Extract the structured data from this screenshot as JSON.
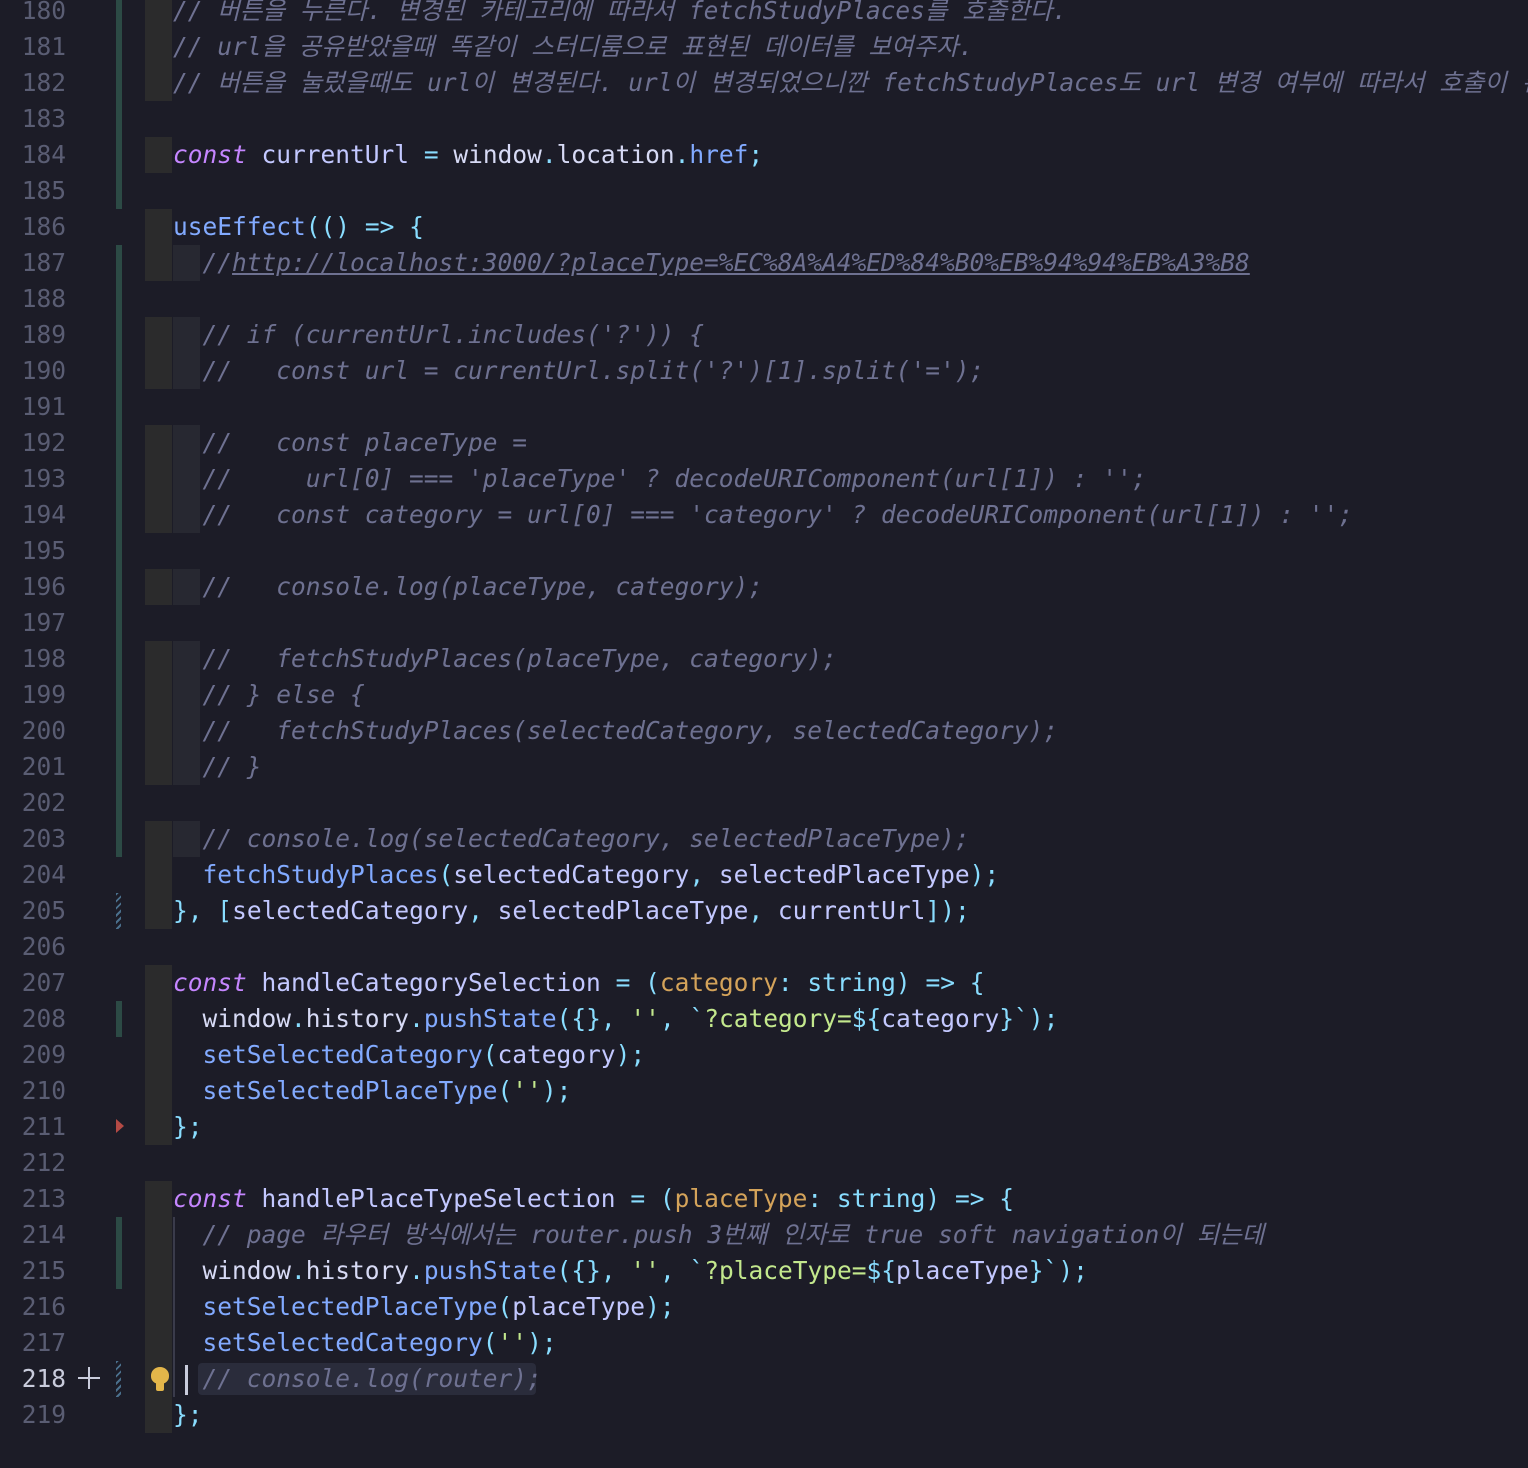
{
  "editor": {
    "active_line": "218",
    "lines": [
      {
        "num": "180",
        "text": "// 버튼을 누른다. 변경된 카테고리에 따라서 fetchStudyPlaces를 호출한다."
      },
      {
        "num": "181",
        "text": "// url을 공유받았을때 똑같이 스터디룸으로 표현된 데이터를 보여주자."
      },
      {
        "num": "182",
        "text": "// 버튼을 눌렀을때도 url이 변경된다. url이 변경되었으니깐 fetchStudyPlaces도 url 변경 여부에 따라서 호출이 된다."
      },
      {
        "num": "183",
        "text": ""
      },
      {
        "num": "184",
        "text": "const currentUrl = window.location.href;"
      },
      {
        "num": "185",
        "text": ""
      },
      {
        "num": "186",
        "text": "useEffect(() => {"
      },
      {
        "num": "187",
        "text": "  //http://localhost:3000/?placeType=%EC%8A%A4%ED%84%B0%EB%94%94%EB%A3%B8"
      },
      {
        "num": "188",
        "text": ""
      },
      {
        "num": "189",
        "text": "  // if (currentUrl.includes('?')) {"
      },
      {
        "num": "190",
        "text": "  //   const url = currentUrl.split('?')[1].split('=');"
      },
      {
        "num": "191",
        "text": ""
      },
      {
        "num": "192",
        "text": "  //   const placeType ="
      },
      {
        "num": "193",
        "text": "  //     url[0] === 'placeType' ? decodeURIComponent(url[1]) : '';"
      },
      {
        "num": "194",
        "text": "  //   const category = url[0] === 'category' ? decodeURIComponent(url[1]) : '';"
      },
      {
        "num": "195",
        "text": ""
      },
      {
        "num": "196",
        "text": "  //   console.log(placeType, category);"
      },
      {
        "num": "197",
        "text": ""
      },
      {
        "num": "198",
        "text": "  //   fetchStudyPlaces(placeType, category);"
      },
      {
        "num": "199",
        "text": "  // } else {"
      },
      {
        "num": "200",
        "text": "  //   fetchStudyPlaces(selectedCategory, selectedCategory);"
      },
      {
        "num": "201",
        "text": "  // }"
      },
      {
        "num": "202",
        "text": ""
      },
      {
        "num": "203",
        "text": "  // console.log(selectedCategory, selectedPlaceType);"
      },
      {
        "num": "204",
        "text": "  fetchStudyPlaces(selectedCategory, selectedPlaceType);"
      },
      {
        "num": "205",
        "text": "}, [selectedCategory, selectedPlaceType, currentUrl]);"
      },
      {
        "num": "206",
        "text": ""
      },
      {
        "num": "207",
        "text": "const handleCategorySelection = (category: string) => {"
      },
      {
        "num": "208",
        "text": "  window.history.pushState({}, '', `?category=${category}`);"
      },
      {
        "num": "209",
        "text": "  setSelectedCategory(category);"
      },
      {
        "num": "210",
        "text": "  setSelectedPlaceType('');"
      },
      {
        "num": "211",
        "text": "};"
      },
      {
        "num": "212",
        "text": ""
      },
      {
        "num": "213",
        "text": "const handlePlaceTypeSelection = (placeType: string) => {"
      },
      {
        "num": "214",
        "text": "  // page 라우터 방식에서는 router.push 3번째 인자로 true soft navigation이 되는데"
      },
      {
        "num": "215",
        "text": "  window.history.pushState({}, '', `?placeType=${placeType}`);"
      },
      {
        "num": "216",
        "text": "  setSelectedPlaceType(placeType);"
      },
      {
        "num": "217",
        "text": "  setSelectedCategory('');"
      },
      {
        "num": "218",
        "text": "  // console.log(router);"
      },
      {
        "num": "219",
        "text": "};"
      }
    ]
  },
  "icons": {
    "lightbulb": "lightbulb-icon",
    "add": "plus-icon",
    "fold": "fold-arrow-icon"
  },
  "colors": {
    "background": "#1c1c27",
    "comment": "#6e7191",
    "keyword": "#c586ff",
    "function": "#82aaff",
    "string": "#c3e88d",
    "param": "#d4a35a",
    "added_gutter": "#2c4a45",
    "lightbulb": "#e3b64a"
  }
}
